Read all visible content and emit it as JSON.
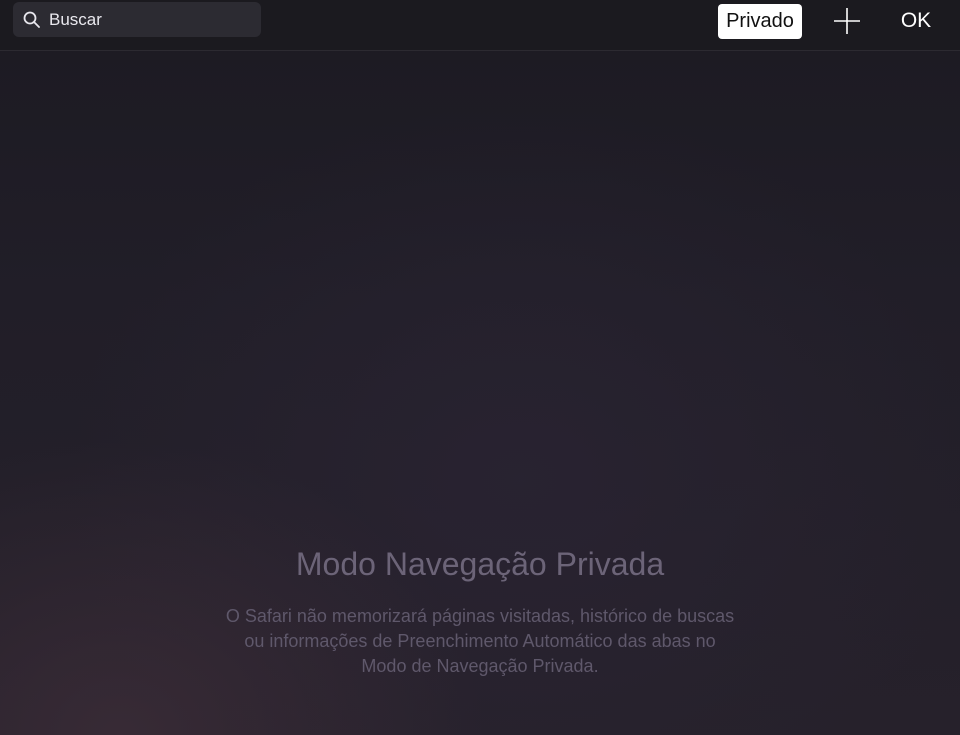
{
  "search": {
    "placeholder": "Buscar",
    "icon": "search-icon"
  },
  "toolbar": {
    "private_label": "Privado",
    "add_icon": "plus-icon",
    "done_label": "OK"
  },
  "private_mode": {
    "title": "Modo Navegação Privada",
    "description_line1": "O Safari não memorizará páginas visitadas, histórico de buscas",
    "description_line2": "ou informações de Preenchimento Automático das abas no",
    "description_line3": "Modo de Navegação Privada."
  },
  "colors": {
    "background": "#211e28",
    "toolbar_background": "#1b1a1f",
    "title_text": "#6c6478",
    "description_text": "#5f586b",
    "private_button_bg": "#ffffff"
  }
}
